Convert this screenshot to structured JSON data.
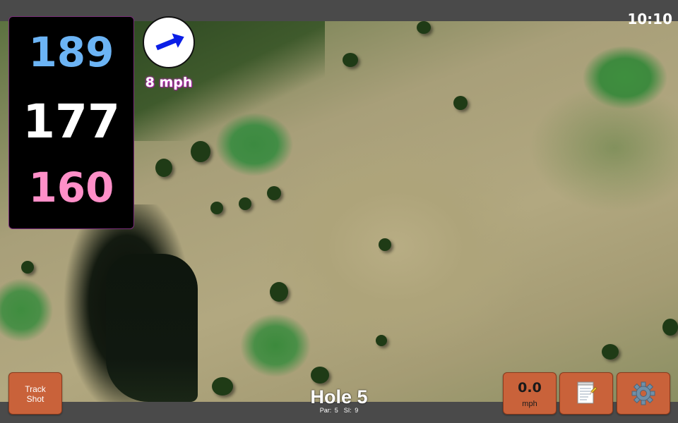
{
  "status": {
    "time": "10:10"
  },
  "distances": {
    "back": "189",
    "middle": "177",
    "front": "160",
    "back_color": "#6cb4f5",
    "middle_color": "#ffffff",
    "front_color": "#ff8fc8"
  },
  "wind": {
    "speed_label": "8 mph",
    "arrow_icon": "arrow-right-icon",
    "arrow_color": "#0a1ee6"
  },
  "hole": {
    "title": "Hole 5",
    "par": "Par: 5",
    "stroke_index": "SI: 9"
  },
  "buttons": {
    "track_shot_line1": "Track",
    "track_shot_line2": "Shot",
    "speed_value": "0.0",
    "speed_unit": "mph",
    "notes_icon": "notepad-icon",
    "settings_icon": "gear-icon",
    "button_color": "#c9623a"
  }
}
